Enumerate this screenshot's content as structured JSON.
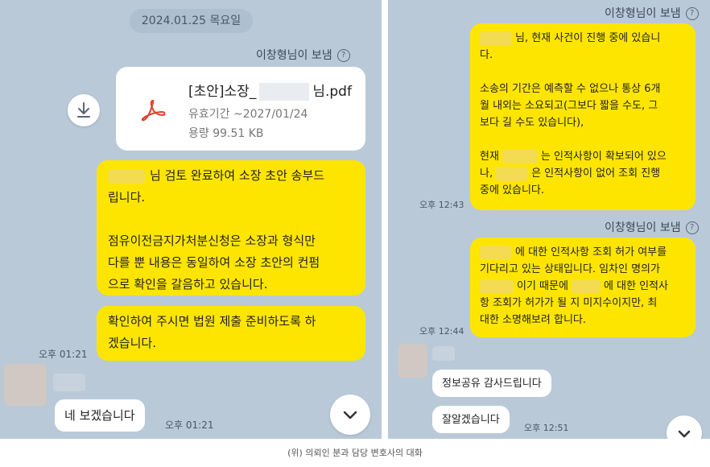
{
  "left": {
    "date": "2024.01.25 목요일",
    "sender": "이창형님이 보냄",
    "help_glyph": "?",
    "file": {
      "name_prefix": "[초안]소장_",
      "name_suffix": "님.pdf",
      "expiry": "유효기간 ~2027/01/24",
      "size": "용량 99.51 KB"
    },
    "msg1_line1": "님 검토 완료하여 소장 초안 송부드",
    "msg1_line2": "립니다.",
    "msg1_line3": "점유이전금지가처분신청은 소장과 형식만",
    "msg1_line4": "다를 뿐 내용은 동일하여 소장 초안의 컨펌",
    "msg1_line5": "으로 확인을 갈음하고 있습니다.",
    "msg2_line1": "확인하여 주시면 법원 제출 준비하도록 하",
    "msg2_line2": "겠습니다.",
    "time1": "오후 01:21",
    "reply": "네 보겠습니다",
    "time2": "오후 01:21"
  },
  "right": {
    "sender_top": "이창형님이 보냄",
    "m1_l1": "님, 현재 사건이 진행 중에 있습니",
    "m1_l2": "다.",
    "m1_l3": "소송의 기간은 예측할 수 없으나 통상 6개",
    "m1_l4": "월 내외는 소요되고(그보다 짧을 수도, 그",
    "m1_l5": "보다 길 수도 있습니다),",
    "m1_l6a": "현재",
    "m1_l6b": "는 인적사항이 확보되어 있으",
    "m1_l7a": "나,",
    "m1_l7b": "은 인적사항이 없어 조회 진행",
    "m1_l8": "중에 있습니다.",
    "time_a": "오후 12:43",
    "sender_mid": "이창형님이 보냄",
    "m2_l1": "에 대한 인적사항 조회 허가 여부를",
    "m2_l2": "기다리고 있는 상태입니다. 임차인 명의가",
    "m2_l3a": "이기 때문에",
    "m2_l3b": "에 대한 인적사",
    "m2_l4": "항 조회가 허가가 될 지 미지수이지만, 최",
    "m2_l5": "대한 소명해보려 합니다.",
    "time_b": "오후 12:44",
    "reply1": "정보공유 감사드립니다",
    "reply2": "잘알겠습니다",
    "time_c": "오후 12:51"
  },
  "caption": "(위) 의뢰인 분과 담당 변호사의 대화",
  "colors": {
    "background": "#b9c9d8",
    "my_bubble": "#fee500",
    "their_bubble": "#ffffff"
  },
  "icons": [
    "download-icon",
    "pdf-icon",
    "help-icon",
    "chevron-down-icon"
  ]
}
